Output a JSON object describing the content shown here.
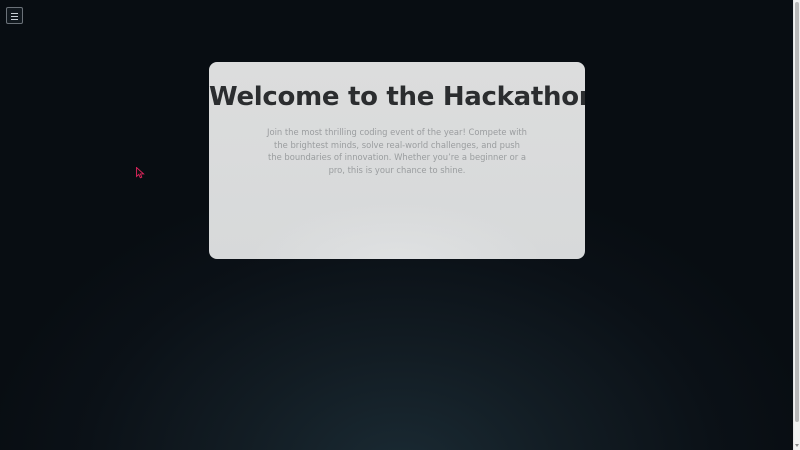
{
  "page": {
    "menu_icon": "hamburger-menu-icon",
    "background_color": "#0b1117",
    "card_color": "#d9dadb",
    "title_color": "#2b2d2f",
    "text_color": "#9a9d9f"
  },
  "hero": {
    "title": "Welcome to the Hackathon",
    "description": "Join the most thrilling coding event of the year! Compete with the brightest minds, solve real-world challenges, and push the boundaries of innovation. Whether you’re a beginner or a pro, this is your chance to shine."
  },
  "cursor": {
    "icon": "mouse-cursor-icon",
    "color": "#e0245e"
  }
}
